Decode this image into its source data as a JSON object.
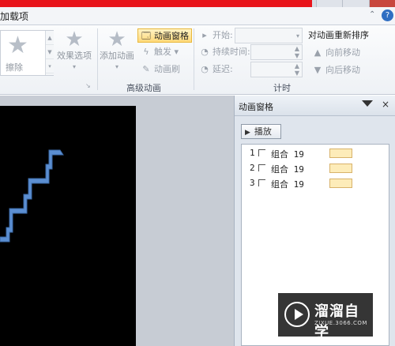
{
  "titlebar": {
    "accent": "#e8141b"
  },
  "tabs": {
    "active_label": "加载项",
    "help": "?"
  },
  "ribbon": {
    "remove_label": "擦除",
    "effect_options_label": "效果选项",
    "add_animation_label": "添加动画",
    "animation_pane_label": "动画窗格",
    "trigger_label": "触发",
    "animation_painter_label": "动画刷",
    "advanced_group_label": "高级动画",
    "start_label": "开始:",
    "duration_label": "持续时间:",
    "delay_label": "延迟:",
    "reorder_label": "对动画重新排序",
    "move_earlier_label": "向前移动",
    "move_later_label": "向后移动",
    "timing_group_label": "计时",
    "icons": [
      "star-icon",
      "animation-pane-icon",
      "lightning-icon",
      "brush-icon",
      "up-arrow-icon",
      "down-arrow-icon"
    ]
  },
  "pane": {
    "title": "动画窗格",
    "play_label": "播放",
    "items": [
      {
        "num": "1",
        "name": "组合 19"
      },
      {
        "num": "2",
        "name": "组合 19"
      },
      {
        "num": "3",
        "name": "组合 19"
      }
    ],
    "bar_color": "#fdecb9"
  },
  "slide": {
    "background": "#000000",
    "stairs_color": "#5b8ed1"
  },
  "watermark": {
    "brand": "溜溜自学",
    "site": "ZIXUE.3066.COM"
  }
}
